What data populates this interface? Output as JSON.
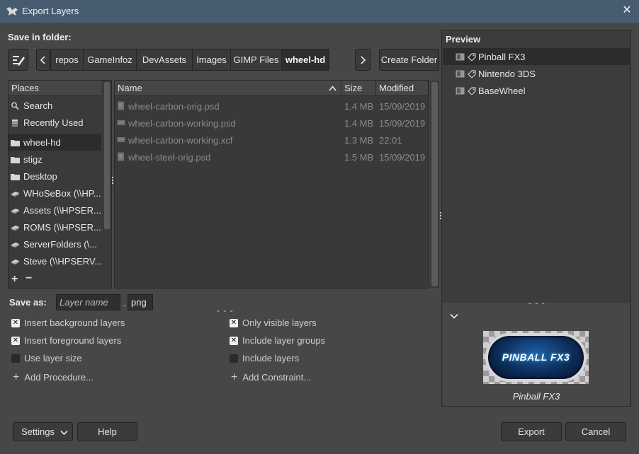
{
  "window": {
    "title": "Export Layers",
    "close": "✕"
  },
  "save_in_folder": {
    "label": "Save in folder:"
  },
  "breadcrumbs": [
    "repos",
    "GameInfoz",
    "DevAssets",
    "Images",
    "GIMP Files",
    "wheel-hd"
  ],
  "create_folder": {
    "label": "Create Folder"
  },
  "places": {
    "header": "Places",
    "items": [
      {
        "label": "Search",
        "icon": "search-icon"
      },
      {
        "label": "Recently Used",
        "icon": "recent-icon"
      },
      {
        "label": "wheel-hd",
        "icon": "folder-icon",
        "selected": true
      },
      {
        "label": "stigz",
        "icon": "folder-icon"
      },
      {
        "label": "Desktop",
        "icon": "folder-icon"
      },
      {
        "label": "WHoSeBox (\\\\HP...",
        "icon": "network-drive-icon"
      },
      {
        "label": "Assets (\\\\HPSER...",
        "icon": "network-drive-icon"
      },
      {
        "label": "ROMS (\\\\HPSER...",
        "icon": "network-drive-icon"
      },
      {
        "label": "ServerFolders (\\...",
        "icon": "network-drive-icon"
      },
      {
        "label": "Steve (\\\\HPSERV...",
        "icon": "network-drive-icon"
      }
    ],
    "add": "+",
    "remove": "−"
  },
  "files": {
    "columns": {
      "name": "Name",
      "size": "Size",
      "modified": "Modified"
    },
    "rows": [
      {
        "name": "wheel-carbon-orig.psd",
        "size": "1.4 MB",
        "modified": "15/09/2019"
      },
      {
        "name": "wheel-carbon-working.psd",
        "size": "1.4 MB",
        "modified": "15/09/2019"
      },
      {
        "name": "wheel-carbon-working.xcf",
        "size": "1.3 MB",
        "modified": "22:01"
      },
      {
        "name": "wheel-steel-orig.psd",
        "size": "1.5 MB",
        "modified": "15/09/2019"
      }
    ]
  },
  "save_as": {
    "label": "Save as:",
    "placeholder": "Layer name",
    "dot": ".",
    "extension": "png"
  },
  "options": {
    "insert_background": {
      "label": "Insert background layers",
      "checked": true
    },
    "insert_foreground": {
      "label": "Insert foreground layers",
      "checked": true
    },
    "use_layer_size": {
      "label": "Use layer size",
      "checked": false
    },
    "only_visible": {
      "label": "Only visible layers",
      "checked": true
    },
    "include_groups": {
      "label": "Include layer groups",
      "checked": true
    },
    "include_layers": {
      "label": "Include layers",
      "checked": false
    },
    "check_mark": "✕"
  },
  "add_procedure": {
    "label": "Add Procedure..."
  },
  "add_constraint": {
    "label": "Add Constraint..."
  },
  "preview": {
    "title": "Preview",
    "layers": [
      {
        "label": "Pinball FX3",
        "selected": true
      },
      {
        "label": "Nintendo 3DS"
      },
      {
        "label": "BaseWheel"
      }
    ],
    "image_text": "PINBALL FX3",
    "caption": "Pinball FX3"
  },
  "buttons": {
    "settings": "Settings",
    "help": "Help",
    "export": "Export",
    "cancel": "Cancel"
  },
  "colors": {
    "titlebar": "#475d6f",
    "background": "#474747",
    "panel": "#3a3a3a",
    "selection": "#2c2c2c"
  }
}
